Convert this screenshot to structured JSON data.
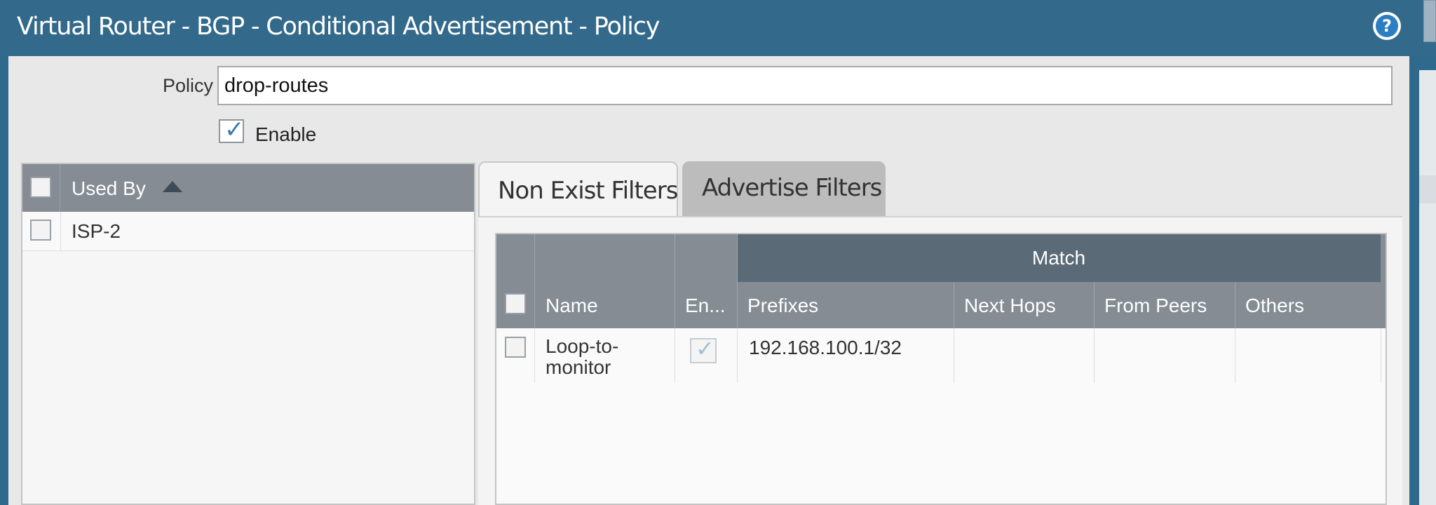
{
  "window": {
    "title": "Virtual Router - BGP - Conditional Advertisement - Policy"
  },
  "policy": {
    "label": "Policy",
    "value": "drop-routes",
    "enable_label": "Enable",
    "enabled": true
  },
  "used_by": {
    "header": "Used By",
    "rows": [
      {
        "name": "ISP-2"
      }
    ]
  },
  "tabs": [
    {
      "label": "Non Exist Filters",
      "active": true
    },
    {
      "label": "Advertise Filters",
      "active": false
    }
  ],
  "filters": {
    "group_header": "Match",
    "columns": {
      "name": "Name",
      "enabled": "En...",
      "prefixes": "Prefixes",
      "next_hops": "Next Hops",
      "from_peers": "From Peers",
      "others": "Others"
    },
    "rows": [
      {
        "name_line1": "Loop-to-",
        "name_line2": "monitor",
        "enabled": true,
        "prefixes": "192.168.100.1/32",
        "next_hops": "",
        "from_peers": "",
        "others": ""
      }
    ]
  },
  "colors": {
    "titlebar": "#336a8b",
    "header": "#858c93",
    "match_header": "#5a6a77",
    "check": "#3c7bb0"
  },
  "icons": {
    "help": "help-icon",
    "sort": "sort-ascending-icon",
    "check": "checkmark-icon"
  }
}
